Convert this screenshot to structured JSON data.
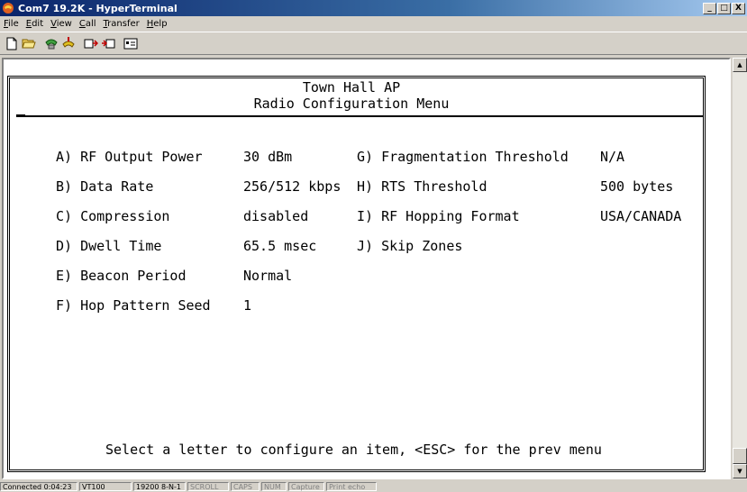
{
  "window": {
    "title": "Com7 19.2K - HyperTerminal",
    "icon": "phone-icon",
    "controls": [
      "_",
      "□",
      "X"
    ]
  },
  "menu": [
    {
      "accel": "F",
      "rest": "ile"
    },
    {
      "accel": "E",
      "rest": "dit"
    },
    {
      "accel": "V",
      "rest": "iew"
    },
    {
      "accel": "C",
      "rest": "all"
    },
    {
      "accel": "T",
      "rest": "ransfer"
    },
    {
      "accel": "H",
      "rest": "elp"
    }
  ],
  "toolbar": [
    "new-icon",
    "open-icon",
    "connect-icon",
    "disconnect-icon",
    "send-icon",
    "receive-icon",
    "properties-icon"
  ],
  "terminal": {
    "site": "Town Hall AP",
    "heading": "Radio Configuration Menu",
    "left_items": [
      {
        "label": "A) RF Output Power",
        "value": "30 dBm"
      },
      {
        "label": "B) Data Rate",
        "value": "256/512 kbps"
      },
      {
        "label": "C) Compression",
        "value": "disabled"
      },
      {
        "label": "D) Dwell Time",
        "value": "65.5 msec"
      },
      {
        "label": "E) Beacon Period",
        "value": "Normal"
      },
      {
        "label": "F) Hop Pattern Seed",
        "value": "1"
      }
    ],
    "right_items": [
      {
        "label": "G) Fragmentation Threshold",
        "value": "N/A"
      },
      {
        "label": "H) RTS Threshold",
        "value": "500 bytes"
      },
      {
        "label": "I) RF Hopping Format",
        "value": "USA/CANADA"
      },
      {
        "label": "J) Skip Zones",
        "value": ""
      }
    ],
    "prompt": "Select a letter to configure an item, <ESC> for the prev menu"
  },
  "status": {
    "connected": "Connected 0:04:23",
    "emulation": "VT100",
    "settings": "19200 8-N-1",
    "scroll": "SCROLL",
    "caps": "CAPS",
    "num": "NUM",
    "capture": "Capture",
    "print_echo": "Print echo"
  }
}
